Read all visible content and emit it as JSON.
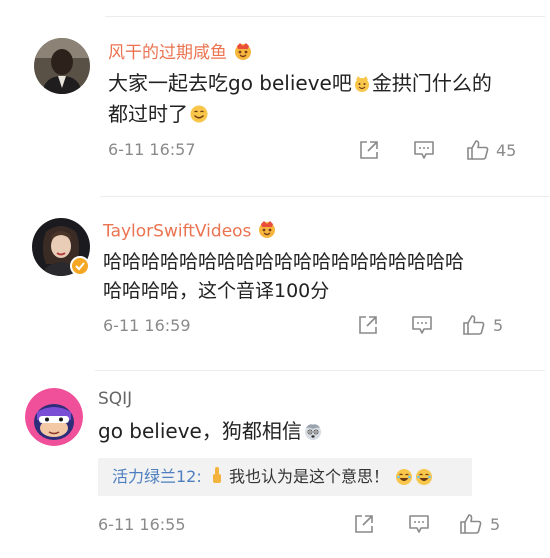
{
  "comments": [
    {
      "user": "风干的过期咸鱼",
      "text_line1": "大家一起去吃go believe吧",
      "text_line1b": "金拱门什么的",
      "text_line2": "都过时了",
      "time": "6-11 16:57",
      "likes": "45",
      "avatar": "profile-photo",
      "badge": "crown-cat-emoji"
    },
    {
      "user": "TaylorSwiftVideos",
      "text_line1": "哈哈哈哈哈哈哈哈哈哈哈哈哈哈哈哈哈哈哈",
      "text_line2": "哈哈哈哈，这个音译100分",
      "time": "6-11 16:59",
      "likes": "5",
      "avatar": "profile-photo",
      "badge": "crown-cat-emoji"
    },
    {
      "user": "SQIJ",
      "text_line1": "go believe，狗都相信",
      "time": "6-11 16:55",
      "likes": "5",
      "avatar": "cartoon-avatar",
      "reply": {
        "name": "活力绿兰12:",
        "text": "我也认为是这个意思！"
      }
    }
  ],
  "icons": [
    "share-icon",
    "comment-icon",
    "like-icon"
  ],
  "colors": {
    "username": "#eb7350",
    "reply_name": "#4d7fc0",
    "meta": "#8a8a8a",
    "reply_bg": "#f2f2f2"
  }
}
